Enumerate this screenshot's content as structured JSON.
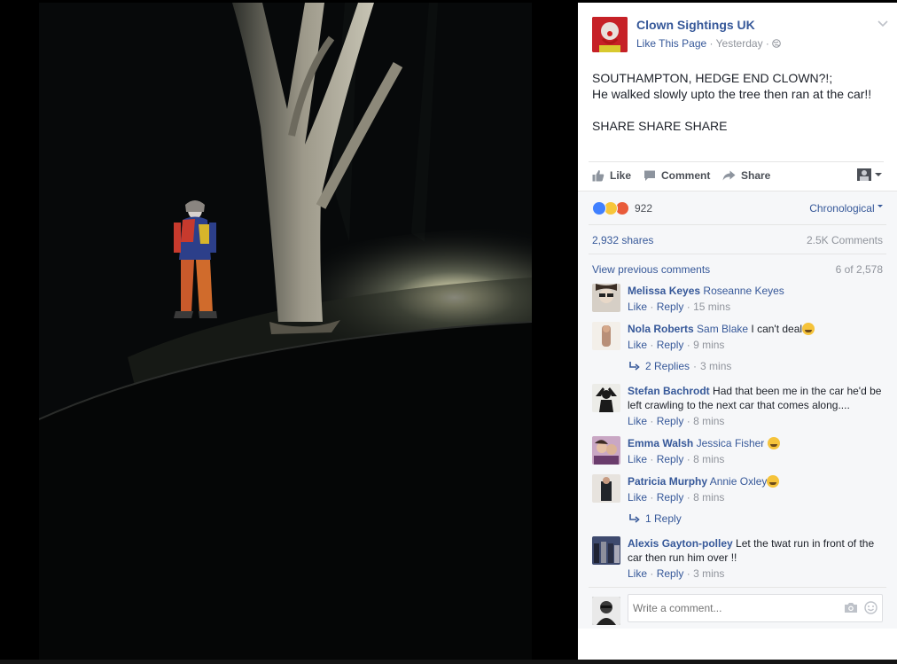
{
  "post": {
    "page_name": "Clown Sightings UK",
    "like_page": "Like This Page",
    "separator": "·",
    "time": "Yesterday",
    "privacy_icon": "globe-icon",
    "text_line1": "SOUTHAMPTON, HEDGE END CLOWN?!;",
    "text_line2": "He walked slowly upto the tree then ran at the car!!",
    "text_line3": "SHARE SHARE SHARE"
  },
  "actions": {
    "like": "Like",
    "comment": "Comment",
    "share": "Share"
  },
  "stats": {
    "reactions_count": "922",
    "reaction_icons": [
      "like-reaction-icon",
      "haha-reaction-icon",
      "angry-reaction-icon"
    ],
    "ordering": "Chronological",
    "shares": "2,932 shares",
    "comments": "2.5K Comments",
    "view_previous": "View previous comments",
    "shown_count": "6 of 2,578"
  },
  "link_labels": {
    "like": "Like",
    "reply": "Reply",
    "dot": "·"
  },
  "comments": [
    {
      "author": "Melissa Keyes",
      "tag": "Roseanne Keyes",
      "text": "",
      "time": "15 mins"
    },
    {
      "author": "Nola Roberts",
      "tag": "Sam Blake",
      "text": "I can't deal",
      "time": "9 mins",
      "replies": "2 Replies",
      "replies_time": "3 mins"
    },
    {
      "author": "Stefan Bachrodt",
      "tag": "",
      "text": "Had that been me in the car he'd be left crawling to the next car that comes along....",
      "time": "8 mins"
    },
    {
      "author": "Emma Walsh",
      "tag": "Jessica Fisher",
      "text": "",
      "time": "8 mins"
    },
    {
      "author": "Patricia Murphy",
      "tag": "Annie Oxley",
      "text": "",
      "time": "8 mins",
      "replies": "1 Reply"
    },
    {
      "author": "Alexis Gayton-polley",
      "tag": "",
      "text": "Let the twat run in front of the car then run him over !!",
      "time": "3 mins"
    }
  ],
  "composer": {
    "placeholder": "Write a comment..."
  },
  "colors": {
    "link": "#365899",
    "muted": "#90949c",
    "panel_bg": "#f6f7f9"
  }
}
